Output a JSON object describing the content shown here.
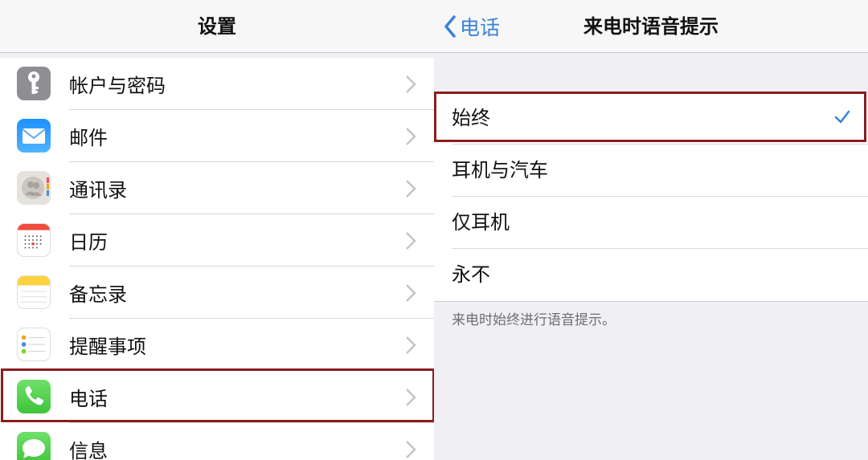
{
  "left": {
    "title": "设置",
    "items": [
      {
        "label": "帐户与密码",
        "icon": "key-icon"
      },
      {
        "label": "邮件",
        "icon": "mail-icon"
      },
      {
        "label": "通讯录",
        "icon": "contacts-icon"
      },
      {
        "label": "日历",
        "icon": "calendar-icon"
      },
      {
        "label": "备忘录",
        "icon": "notes-icon"
      },
      {
        "label": "提醒事项",
        "icon": "reminders-icon"
      },
      {
        "label": "电话",
        "icon": "phone-icon"
      },
      {
        "label": "信息",
        "icon": "messages-icon"
      }
    ]
  },
  "right": {
    "back_label": "电话",
    "title": "来电时语音提示",
    "options": [
      {
        "label": "始终",
        "selected": true
      },
      {
        "label": "耳机与汽车",
        "selected": false
      },
      {
        "label": "仅耳机",
        "selected": false
      },
      {
        "label": "永不",
        "selected": false
      }
    ],
    "footnote": "来电时始终进行语音提示。"
  },
  "colors": {
    "accent": "#3b82d6",
    "highlight_border": "#8b1d1d",
    "phone_green": "#4cd964"
  }
}
